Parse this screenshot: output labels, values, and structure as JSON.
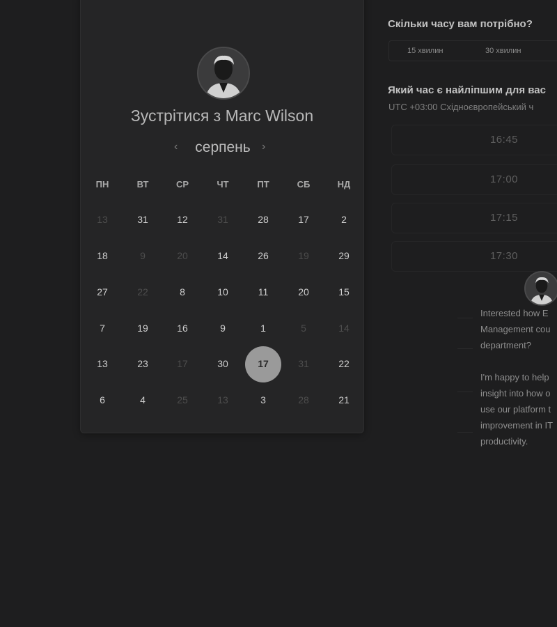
{
  "host": {
    "title": "Зустрітися з Marc Wilson",
    "avatar_alt": "Marc Wilson"
  },
  "calendar": {
    "month": "серпень",
    "prev_icon": "chevron-left-icon",
    "next_icon": "chevron-right-icon",
    "weekdays": [
      "ПН",
      "ВТ",
      "СР",
      "ЧТ",
      "ПТ",
      "СБ",
      "НД"
    ],
    "weeks": [
      [
        {
          "d": "13",
          "muted": true
        },
        {
          "d": "31"
        },
        {
          "d": "12"
        },
        {
          "d": "31",
          "muted": true
        },
        {
          "d": "28"
        },
        {
          "d": "17"
        },
        {
          "d": "2"
        }
      ],
      [
        {
          "d": "18"
        },
        {
          "d": "9",
          "muted": true
        },
        {
          "d": "20",
          "muted": true
        },
        {
          "d": "14"
        },
        {
          "d": "26"
        },
        {
          "d": "19",
          "muted": true
        },
        {
          "d": "29"
        }
      ],
      [
        {
          "d": "27"
        },
        {
          "d": "22",
          "muted": true
        },
        {
          "d": "8"
        },
        {
          "d": "10"
        },
        {
          "d": "11"
        },
        {
          "d": "20"
        },
        {
          "d": "15"
        }
      ],
      [
        {
          "d": "7"
        },
        {
          "d": "19"
        },
        {
          "d": "16"
        },
        {
          "d": "9"
        },
        {
          "d": "1"
        },
        {
          "d": "5",
          "muted": true
        },
        {
          "d": "14",
          "muted": true
        }
      ],
      [
        {
          "d": "13"
        },
        {
          "d": "23"
        },
        {
          "d": "17",
          "muted": true
        },
        {
          "d": "30"
        },
        {
          "d": "17",
          "selected": true
        },
        {
          "d": "31",
          "muted": true
        },
        {
          "d": "22"
        }
      ],
      [
        {
          "d": "6"
        },
        {
          "d": "4"
        },
        {
          "d": "25",
          "muted": true
        },
        {
          "d": "13",
          "muted": true
        },
        {
          "d": "3"
        },
        {
          "d": "28",
          "muted": true
        },
        {
          "d": "21"
        }
      ]
    ]
  },
  "duration": {
    "question": "Скільки часу вам потрібно?",
    "options": [
      "15 хвилин",
      "30 хвилин"
    ]
  },
  "time": {
    "question": "Який час є найліпшим для вас",
    "timezone": "UTC +03:00 Східноєвропейський ч",
    "slots": [
      "16:45",
      "17:00",
      "17:15",
      "17:30"
    ]
  },
  "message": {
    "lines_1": [
      "Interested how E",
      "Management cou",
      "department?"
    ],
    "lines_2": [
      "I'm happy to help",
      "insight into how o",
      "use our platform t",
      "improvement in IT",
      "productivity."
    ]
  }
}
